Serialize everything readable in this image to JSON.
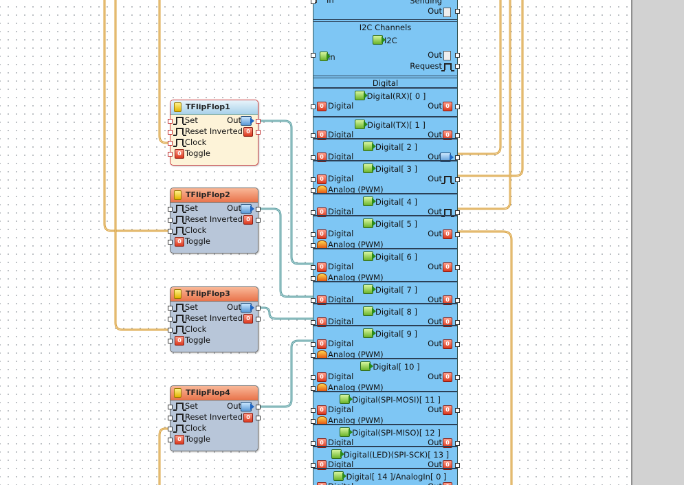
{
  "canvas": {
    "background": "#ffffff",
    "dot_color": "#9aa0a6"
  },
  "colors": {
    "wire_orange": "#d9a03a",
    "wire_teal": "#5a9fa3",
    "board_blue": "#7ec6f4",
    "title_orange": "#ef8a60"
  },
  "flipflops": [
    {
      "title": "TFlipFlop1",
      "selected": true,
      "inputs": [
        "Set",
        "Reset",
        "Clock",
        "Toggle"
      ],
      "outputs": [
        "Out",
        "Inverted"
      ]
    },
    {
      "title": "TFlipFlop2",
      "selected": false,
      "inputs": [
        "Set",
        "Reset",
        "Clock",
        "Toggle"
      ],
      "outputs": [
        "Out",
        "Inverted"
      ]
    },
    {
      "title": "TFlipFlop3",
      "selected": false,
      "inputs": [
        "Set",
        "Reset",
        "Clock",
        "Toggle"
      ],
      "outputs": [
        "Out",
        "Inverted"
      ]
    },
    {
      "title": "TFlipFlop4",
      "selected": false,
      "inputs": [
        "Set",
        "Reset",
        "Clock",
        "Toggle"
      ],
      "outputs": [
        "Out",
        "Inverted"
      ]
    }
  ],
  "board": {
    "top": {
      "in": "In",
      "sending": "Sending",
      "out": "Out"
    },
    "i2c": {
      "header": "I2C Channels",
      "name": "I2C",
      "in": "In",
      "out": "Out",
      "request": "Request"
    },
    "digital_header": "Digital",
    "channels": [
      {
        "title": "Digital(RX)[ 0 ]",
        "in": "Digital",
        "out": "Out"
      },
      {
        "title": "Digital(TX)[ 1 ]",
        "in": "Digital",
        "out": "Out"
      },
      {
        "title": "Digital[ 2 ]",
        "in": "Digital",
        "out": "Out"
      },
      {
        "title": "Digital[ 3 ]",
        "in": "Digital",
        "out": "Out",
        "analog": "Analog (PWM)"
      },
      {
        "title": "Digital[ 4 ]",
        "in": "Digital",
        "out": "Out"
      },
      {
        "title": "Digital[ 5 ]",
        "in": "Digital",
        "out": "Out",
        "analog": "Analog (PWM)"
      },
      {
        "title": "Digital[ 6 ]",
        "in": "Digital",
        "out": "Out",
        "analog": "Analog (PWM)"
      },
      {
        "title": "Digital[ 7 ]",
        "in": "Digital",
        "out": "Out"
      },
      {
        "title": "Digital[ 8 ]",
        "in": "Digital",
        "out": "Out"
      },
      {
        "title": "Digital[ 9 ]",
        "in": "Digital",
        "out": "Out",
        "analog": "Analog (PWM)"
      },
      {
        "title": "Digital[ 10 ]",
        "in": "Digital",
        "out": "Out",
        "analog": "Analog (PWM)"
      },
      {
        "title": "Digital(SPI-MOSI)[ 11 ]",
        "in": "Digital",
        "out": "Out",
        "analog": "Analog (PWM)"
      },
      {
        "title": "Digital(SPI-MISO)[ 12 ]",
        "in": "Digital",
        "out": "Out"
      },
      {
        "title": "Digital(LED)(SPI-SCK)[ 13 ]",
        "in": "Digital",
        "out": "Out"
      },
      {
        "title": "Digital[ 14 ]/AnalogIn[ 0 ]",
        "in": "Digital",
        "out": "Out"
      }
    ]
  }
}
